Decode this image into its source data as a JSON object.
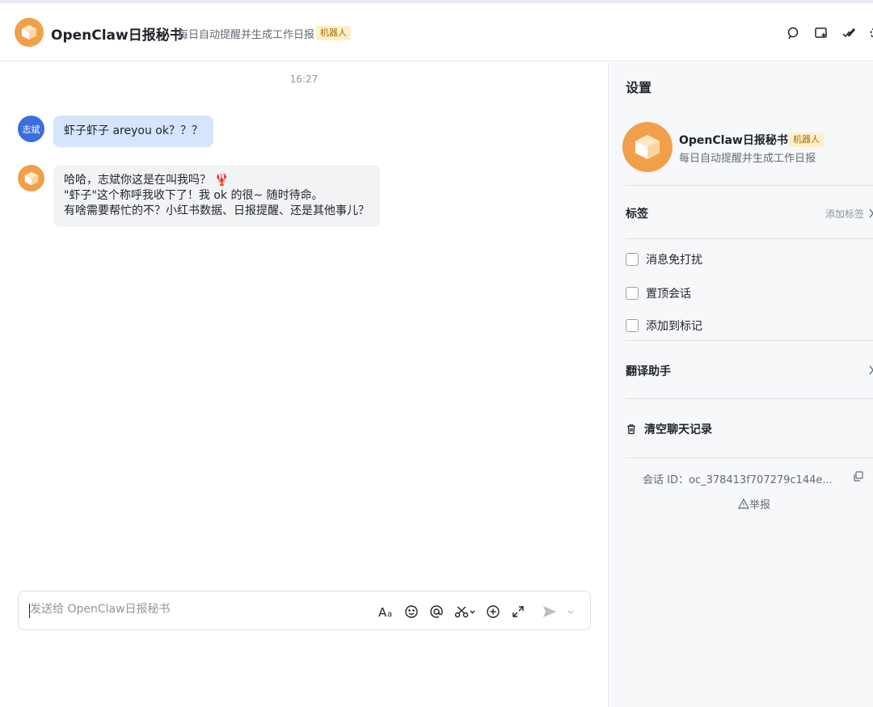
{
  "header": {
    "title": "OpenClaw日报秘书",
    "subtitle": "每日自动提醒并生成工作日报",
    "badge": "机器人",
    "icons": [
      "search-icon",
      "add-screen-icon",
      "pen-check-icon",
      "settings-icon"
    ]
  },
  "chat": {
    "timestamp": "16:27",
    "messages": [
      {
        "sender": "user",
        "avatar_text": "志斌",
        "lines": [
          "虾子虾子 areyou ok？？？"
        ]
      },
      {
        "sender": "bot",
        "lines": [
          "哈哈，志斌你这是在叫我吗？",
          "\"虾子\"这个称呼我收下了！我 ok 的很~ 随时待命。",
          "有啥需要帮忙的不？小红书数据、日报提醒、还是其他事儿？"
        ],
        "emoji": "🦞"
      }
    ]
  },
  "composer": {
    "placeholder": "发送给 OpenClaw日报秘书",
    "value": "",
    "tools": [
      "text-format-icon",
      "emoji-icon",
      "mention-icon",
      "scissors-icon",
      "add-circle-icon",
      "expand-icon",
      "send-icon",
      "chevron-down-icon"
    ]
  },
  "panel": {
    "title": "设置",
    "bot_name": "OpenClaw日报秘书",
    "badge": "机器人",
    "bot_desc": "每日自动提醒并生成工作日报",
    "tags_label": "标签",
    "add_tag": "添加标签",
    "options": [
      {
        "label": "消息免打扰",
        "checked": false
      },
      {
        "label": "置顶会话",
        "checked": false
      },
      {
        "label": "添加到标记",
        "checked": false
      }
    ],
    "translate_label": "翻译助手",
    "clear_label": "清空聊天记录",
    "session_id": "会话 ID：oc_378413f707279c144e...",
    "report_label": "举报"
  },
  "colors": {
    "accent": "#3b6fe0",
    "bot_avatar": "#f0a04b",
    "my_bubble": "#d6e4fc",
    "bot_bubble": "#f2f3f5",
    "badge_bg": "#fdf0c9"
  }
}
